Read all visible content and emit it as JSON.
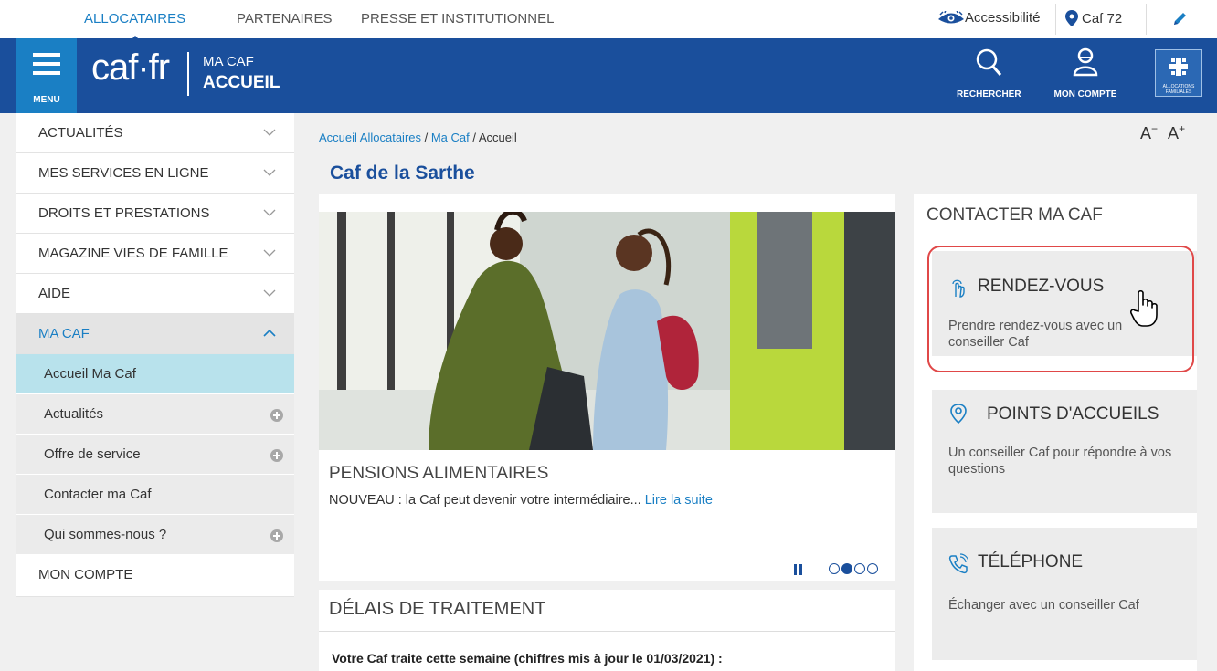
{
  "topnav": {
    "tabs": [
      "ALLOCATAIRES",
      "PARTENAIRES",
      "PRESSE ET INSTITUTIONNEL"
    ],
    "accessibility_label": "Accessibilité",
    "caf_label": "Caf 72",
    "accessibility_icon": "accessibility-icon",
    "location_icon": "map-pin-icon",
    "edit_icon": "pencil-icon"
  },
  "header": {
    "menu_label": "MENU",
    "logo_text": "caf·fr",
    "section_line1": "MA CAF",
    "section_line2": "ACCUEIL",
    "search_label": "RECHERCHER",
    "account_label": "MON COMPTE",
    "crest_text": "ALLOCATIONS FAMILIALES"
  },
  "sidebar": {
    "items": [
      {
        "label": "ACTUALITÉS"
      },
      {
        "label": "MES SERVICES EN LIGNE"
      },
      {
        "label": "DROITS ET PRESTATIONS"
      },
      {
        "label": "MAGAZINE VIES DE FAMILLE"
      },
      {
        "label": "AIDE"
      },
      {
        "label": "MA CAF"
      }
    ],
    "subitems": [
      {
        "label": "Accueil Ma Caf"
      },
      {
        "label": "Actualités"
      },
      {
        "label": "Offre de service"
      },
      {
        "label": "Contacter ma Caf"
      },
      {
        "label": "Qui sommes-nous ?"
      }
    ],
    "last_item": "MON COMPTE"
  },
  "breadcrumb": {
    "part1": "Accueil Allocataires",
    "sep1": " / ",
    "part2": "Ma Caf",
    "sep2": " / ",
    "current": "Accueil"
  },
  "font_controls": {
    "decrease": "A",
    "decrease_sup": "−",
    "increase": "A",
    "increase_sup": "+"
  },
  "page_title": "Caf de la Sarthe",
  "carousel": {
    "heading": "PENSIONS ALIMENTAIRES",
    "text": "NOUVEAU : la Caf peut devenir votre intermédiaire... ",
    "link": "Lire la suite",
    "active_slide": 2,
    "slide_count": 4
  },
  "delays": {
    "heading": "DÉLAIS DE TRAITEMENT",
    "text": "Votre Caf traite cette semaine (chiffres mis à jour le 01/03/2021) :"
  },
  "contact": {
    "heading": "CONTACTER MA CAF",
    "boxes": [
      {
        "icon": "hand-touch-icon",
        "title": "RENDEZ-VOUS",
        "desc": "Prendre rendez-vous avec un conseiller Caf"
      },
      {
        "icon": "location-pin-icon",
        "title": "POINTS D'ACCUEILS",
        "desc": "Un conseiller Caf pour répondre à vos questions"
      },
      {
        "icon": "phone-icon",
        "title": "TÉLÉPHONE",
        "desc": "Échanger avec un conseiller Caf"
      }
    ]
  },
  "colors": {
    "brand_blue": "#1a4f9c",
    "accent_blue": "#1a7fc4",
    "highlight_red": "#e04848"
  }
}
